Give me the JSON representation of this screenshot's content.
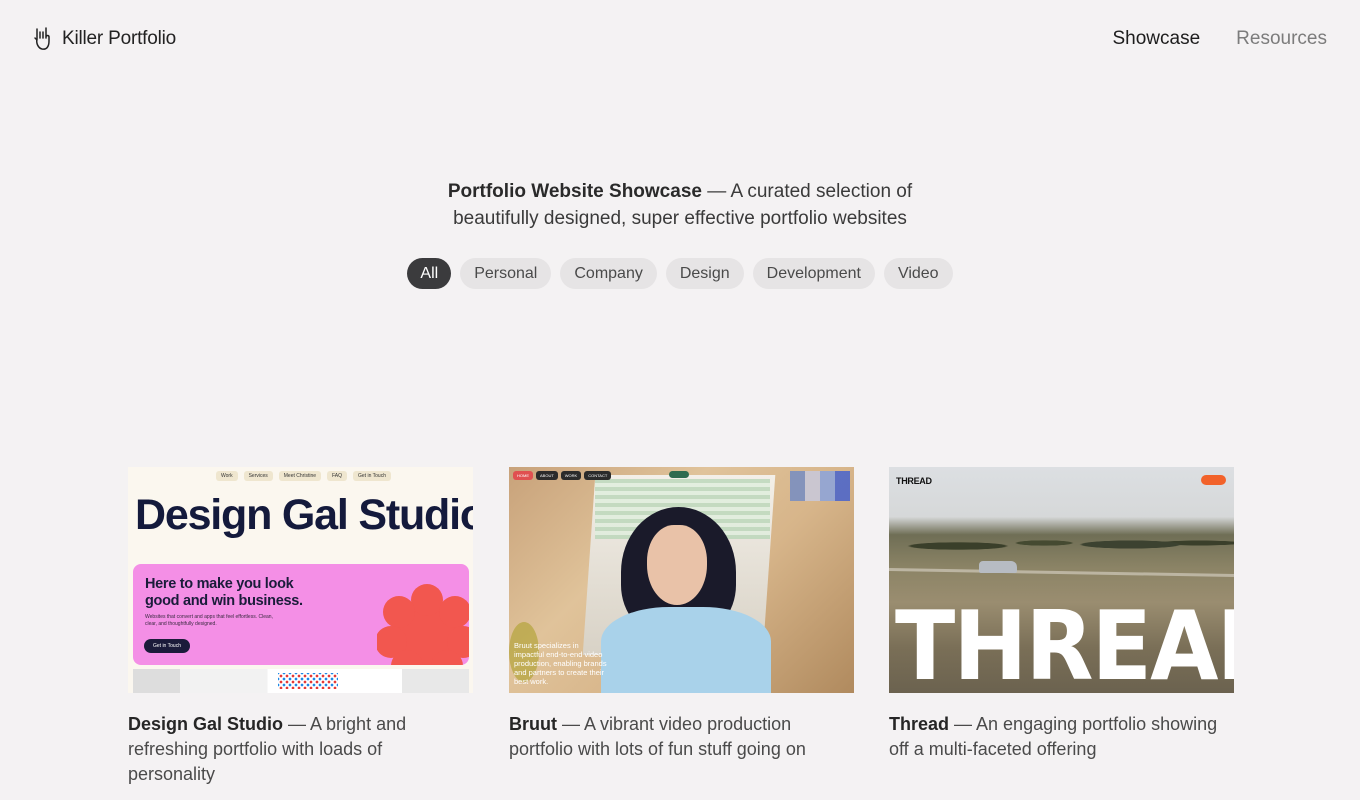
{
  "brand": {
    "name": "Killer Portfolio",
    "icon": "rock-hand-icon"
  },
  "nav": {
    "items": [
      "Showcase",
      "Resources"
    ],
    "active": "Showcase"
  },
  "hero": {
    "title": "Portfolio Website Showcase",
    "subtitle_line1": " — A curated selection of",
    "subtitle_line2": "beautifully designed, super effective portfolio websites"
  },
  "filters": {
    "selected": "All",
    "items": [
      "All",
      "Personal",
      "Company",
      "Design",
      "Development",
      "Video"
    ]
  },
  "cards": [
    {
      "name": "Design Gal Studio",
      "description": " — A bright and refreshing portfolio with loads of personality",
      "thumb": {
        "nav": [
          "Work",
          "Services",
          "Meet Christine",
          "FAQ",
          "Get in Touch"
        ],
        "headline": "Design Gal Studio",
        "tagline": "Here to make you look good and win business.",
        "body": "Websites that convert and apps that feel effortless. Clean, clear, and thoughtfully designed.",
        "cta": "Get in Touch"
      }
    },
    {
      "name": "Bruut",
      "description": " — A vibrant video production portfolio with lots of fun stuff going on",
      "thumb": {
        "nav": [
          "HOME",
          "ABOUT",
          "WORK",
          "CONTACT"
        ],
        "overlay": "Bruut specializes in impactful end-to-end video production, enabling brands and partners to create their best work."
      }
    },
    {
      "name": "Thread",
      "description": " — An engaging portfolio showing off a multi-faceted offering",
      "thumb": {
        "brand": "THREAD",
        "headline": "THREAD"
      }
    }
  ]
}
